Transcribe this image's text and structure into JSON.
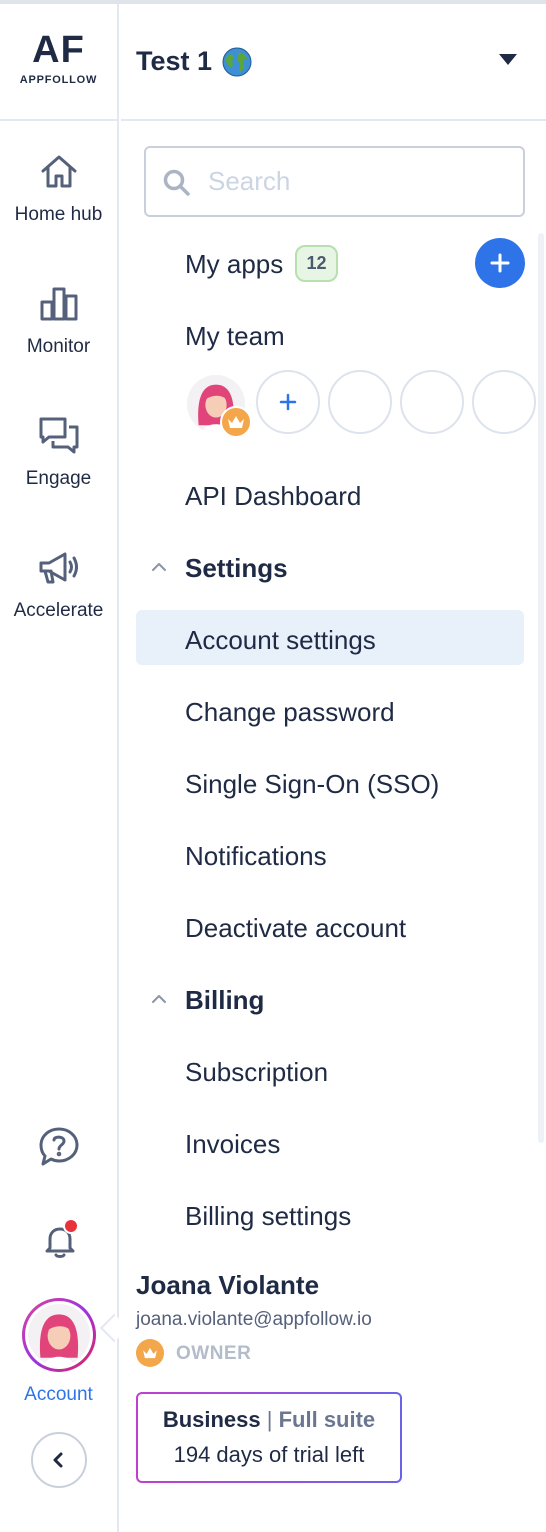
{
  "brand": {
    "logo_mark": "AF",
    "logo_word": "APPFOLLOW"
  },
  "workspace": {
    "name": "Test 1"
  },
  "rail": {
    "items": [
      {
        "label": "Home hub",
        "icon": "home-icon"
      },
      {
        "label": "Monitor",
        "icon": "bar-chart-icon"
      },
      {
        "label": "Engage",
        "icon": "chat-bubbles-icon"
      },
      {
        "label": "Accelerate",
        "icon": "megaphone-icon"
      }
    ],
    "account_label": "Account"
  },
  "search": {
    "placeholder": "Search",
    "value": ""
  },
  "menu": {
    "my_apps": "My apps",
    "apps_count": "12",
    "my_team": "My team",
    "api_dashboard": "API Dashboard",
    "settings": {
      "title": "Settings",
      "items": [
        "Account settings",
        "Change password",
        "Single Sign-On (SSO)",
        "Notifications",
        "Deactivate account"
      ]
    },
    "billing": {
      "title": "Billing",
      "items": [
        "Subscription",
        "Invoices",
        "Billing settings"
      ]
    }
  },
  "user": {
    "name": "Joana Violante",
    "email": "joana.violante@appfollow.io",
    "role": "OWNER"
  },
  "plan": {
    "name": "Business",
    "separator": "|",
    "suite": "Full suite",
    "trial": "194 days of trial left"
  },
  "colors": {
    "accent": "#2e74e8",
    "text": "#1f2a44",
    "active_bg": "#e8f0fa",
    "notification_dot": "#e8333d",
    "crown": "#f3a64a"
  }
}
